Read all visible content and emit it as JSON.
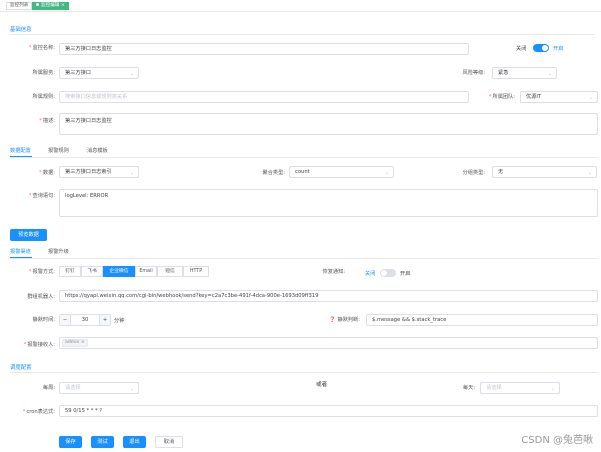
{
  "tabs": [
    {
      "label": "监控列表"
    },
    {
      "label": "监控编辑"
    }
  ],
  "basic": {
    "title": "基础信息",
    "name_label": "监控名称:",
    "name_value": "第三方接口日志监控",
    "toggle_off": "关闭",
    "toggle_on": "开启",
    "service_label": "所属服务:",
    "service_value": "第三方接口",
    "risk_label": "风险等级:",
    "risk_value": "紧急",
    "rule_label": "所属规则:",
    "rule_placeholder": "搜索接口信息或规则类关系",
    "team_label": "所属团队:",
    "team_value": "优源IT",
    "desc_label": "描述:",
    "desc_value": "第三方接口日志监控"
  },
  "data_tabs": [
    {
      "label": "数据配置"
    },
    {
      "label": "报警规则"
    },
    {
      "label": "消息模板"
    }
  ],
  "data": {
    "source_label": "数据:",
    "source_value": "第三方接口日志索引",
    "agg_label": "聚合类型:",
    "agg_value": "count",
    "group_label": "分组类型:",
    "group_value": "无",
    "query_label": "查询语句:",
    "query_value": "logLevel: ERROR",
    "preview_button": "预览数据"
  },
  "notify_tabs": [
    {
      "label": "报警渠道"
    },
    {
      "label": "报警升级"
    }
  ],
  "notify": {
    "method_label": "报警方式:",
    "methods": [
      "钉钉",
      "飞书",
      "企业微信",
      "Email",
      "短信",
      "HTTP"
    ],
    "recovery_label": "恢复通知:",
    "recovery_off": "关闭",
    "recovery_on": "开启",
    "robot_label": "群组机器人:",
    "robot_value": "https://qyapi.weixin.qq.com/cgi-bin/webhook/send?key=c2a7c3be-491f-4dca-900e-1693d09ff319",
    "interval_label": "静默时间:",
    "interval_minus": "−",
    "interval_value": "30",
    "interval_plus": "+",
    "interval_unit": "分钟",
    "content_label": "静默判断:",
    "content_value": "$.message && $.stack_trace",
    "receiver_label": "报警接收人:",
    "receiver_tag": "admin",
    "receiver_tag_close": "×"
  },
  "schedule": {
    "title": "调度配置",
    "every_label": "每周:",
    "every_placeholder": "请选择",
    "or_text": "或者",
    "daily_label": "每天:",
    "daily_placeholder": "请选择",
    "cron_label": "cron表达式:",
    "cron_value": "59 0/15 * * * ?"
  },
  "footer": {
    "save": "保存",
    "test": "测试",
    "exit": "退出",
    "cancel": "取消"
  },
  "watermark": "CSDN @兔芭啾",
  "colors": {
    "primary": "#1890ff",
    "active_tab": "#42b983",
    "required": "#f56c6c"
  }
}
